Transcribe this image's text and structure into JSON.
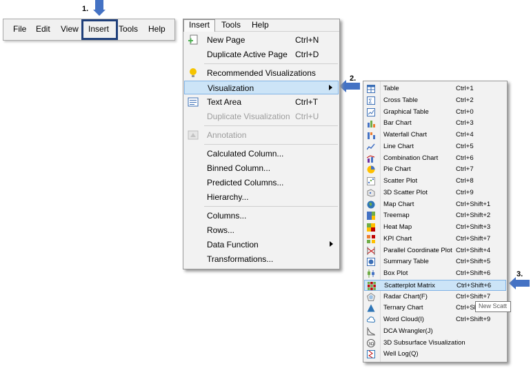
{
  "steps": {
    "s1": "1.",
    "s2": "2.",
    "s3": "3."
  },
  "menubar": {
    "items": [
      {
        "label": "File",
        "name": "menubar-file"
      },
      {
        "label": "Edit",
        "name": "menubar-edit"
      },
      {
        "label": "View",
        "name": "menubar-view"
      },
      {
        "label": "Insert",
        "name": "menubar-insert"
      },
      {
        "label": "Tools",
        "name": "menubar-tools"
      },
      {
        "label": "Help",
        "name": "menubar-help"
      }
    ]
  },
  "insert_menu": {
    "tabs": [
      "Insert",
      "Tools",
      "Help"
    ],
    "items": [
      {
        "label": "New Page",
        "shortcut": "Ctrl+N",
        "icon": "new-page-icon",
        "disabled": false
      },
      {
        "label": "Duplicate Active Page",
        "shortcut": "Ctrl+D",
        "icon": "",
        "disabled": false
      },
      {
        "label": "Recommended Visualizations",
        "shortcut": "",
        "icon": "lightbulb-icon",
        "disabled": false
      },
      {
        "label": "Visualization",
        "shortcut": "",
        "icon": "",
        "disabled": false,
        "submenu": true,
        "highlighted": true
      },
      {
        "label": "Text Area",
        "shortcut": "Ctrl+T",
        "icon": "text-area-icon",
        "disabled": false
      },
      {
        "label": "Duplicate Visualization",
        "shortcut": "Ctrl+U",
        "icon": "",
        "disabled": true
      },
      {
        "label": "Annotation",
        "shortcut": "",
        "icon": "annotation-icon",
        "disabled": true
      },
      {
        "label": "Calculated Column...",
        "shortcut": "",
        "icon": "",
        "disabled": false
      },
      {
        "label": "Binned Column...",
        "shortcut": "",
        "icon": "",
        "disabled": false
      },
      {
        "label": "Predicted Columns...",
        "shortcut": "",
        "icon": "",
        "disabled": false
      },
      {
        "label": "Hierarchy...",
        "shortcut": "",
        "icon": "",
        "disabled": false
      },
      {
        "label": "Columns...",
        "shortcut": "",
        "icon": "",
        "disabled": false
      },
      {
        "label": "Rows...",
        "shortcut": "",
        "icon": "",
        "disabled": false
      },
      {
        "label": "Data Function",
        "shortcut": "",
        "icon": "",
        "disabled": false,
        "submenu": true
      },
      {
        "label": "Transformations...",
        "shortcut": "",
        "icon": "",
        "disabled": false
      }
    ]
  },
  "visualization_menu": {
    "items": [
      {
        "label": "Table",
        "shortcut": "Ctrl+1",
        "icon": "table-icon"
      },
      {
        "label": "Cross Table",
        "shortcut": "Ctrl+2",
        "icon": "cross-table-icon"
      },
      {
        "label": "Graphical Table",
        "shortcut": "Ctrl+0",
        "icon": "graphical-table-icon"
      },
      {
        "label": "Bar Chart",
        "shortcut": "Ctrl+3",
        "icon": "bar-chart-icon"
      },
      {
        "label": "Waterfall Chart",
        "shortcut": "Ctrl+4",
        "icon": "waterfall-chart-icon"
      },
      {
        "label": "Line Chart",
        "shortcut": "Ctrl+5",
        "icon": "line-chart-icon"
      },
      {
        "label": "Combination Chart",
        "shortcut": "Ctrl+6",
        "icon": "combination-chart-icon"
      },
      {
        "label": "Pie Chart",
        "shortcut": "Ctrl+7",
        "icon": "pie-chart-icon"
      },
      {
        "label": "Scatter Plot",
        "shortcut": "Ctrl+8",
        "icon": "scatter-plot-icon"
      },
      {
        "label": "3D Scatter Plot",
        "shortcut": "Ctrl+9",
        "icon": "3d-scatter-plot-icon"
      },
      {
        "label": "Map Chart",
        "shortcut": "Ctrl+Shift+1",
        "icon": "map-chart-icon"
      },
      {
        "label": "Treemap",
        "shortcut": "Ctrl+Shift+2",
        "icon": "treemap-icon"
      },
      {
        "label": "Heat Map",
        "shortcut": "Ctrl+Shift+3",
        "icon": "heat-map-icon"
      },
      {
        "label": "KPI Chart",
        "shortcut": "Ctrl+Shift+7",
        "icon": "kpi-chart-icon"
      },
      {
        "label": "Parallel Coordinate Plot",
        "shortcut": "Ctrl+Shift+4",
        "icon": "parallel-coordinate-icon"
      },
      {
        "label": "Summary Table",
        "shortcut": "Ctrl+Shift+5",
        "icon": "summary-table-icon"
      },
      {
        "label": "Box Plot",
        "shortcut": "Ctrl+Shift+6",
        "icon": "box-plot-icon"
      },
      {
        "label": "Scatterplot Matrix",
        "shortcut": "Ctrl+Shift+6",
        "icon": "scatterplot-matrix-icon",
        "highlighted": true
      },
      {
        "label": "Radar Chart(F)",
        "shortcut": "Ctrl+Shift+7",
        "icon": "radar-chart-icon"
      },
      {
        "label": "Ternary Chart",
        "shortcut": "Ctrl+Sh",
        "icon": "ternary-chart-icon"
      },
      {
        "label": "Word Cloud(I)",
        "shortcut": "Ctrl+Shift+9",
        "icon": "word-cloud-icon"
      },
      {
        "label": "DCA Wrangler(J)",
        "shortcut": "",
        "icon": "dca-wrangler-icon"
      },
      {
        "label": "3D Subsurface Visualization",
        "shortcut": "",
        "icon": "3d-subsurface-icon"
      },
      {
        "label": "Well Log(Q)",
        "shortcut": "",
        "icon": "well-log-icon"
      }
    ]
  },
  "tooltip": {
    "text": "New Scatt"
  },
  "colors": {
    "arrow": "#4472c4",
    "highlight_bg": "#cce4f7",
    "highlight_border": "#7fb2e5",
    "insert_box": "#1f3f7a"
  }
}
